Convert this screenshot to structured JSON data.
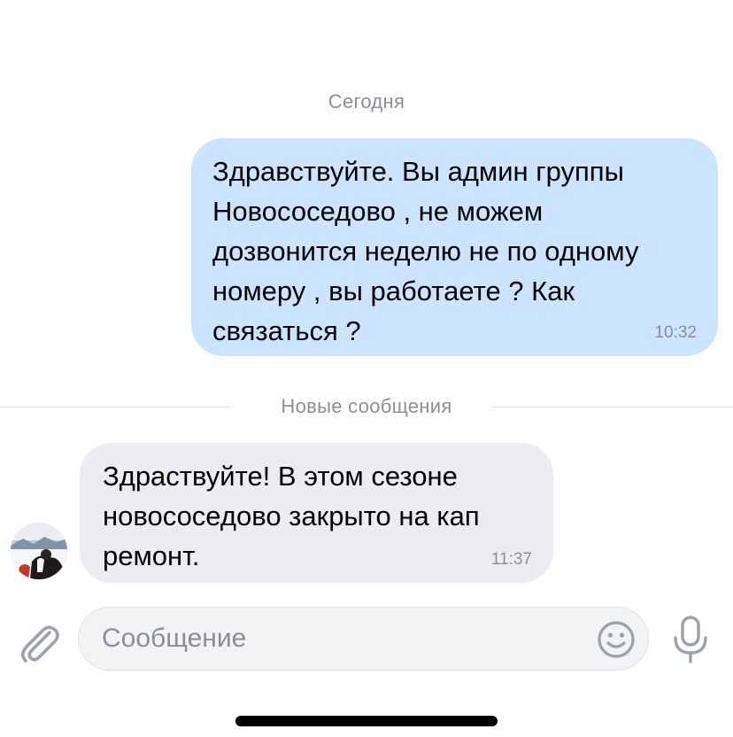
{
  "chat": {
    "date_label": "Сегодня",
    "new_messages_label": "Новые сообщения",
    "messages": [
      {
        "direction": "outgoing",
        "lines": [
          "Здравствуйте. Вы админ группы",
          "Новососедово , не можем",
          "дозвонится неделю не по одному",
          "номеру , вы работаете ? Как",
          "связаться ?"
        ],
        "time": "10:32"
      },
      {
        "direction": "incoming",
        "lines": [
          "Здраствуйте!  В этом сезоне",
          "новососедово закрыто на кап",
          "ремонт."
        ],
        "time": "11:37"
      }
    ]
  },
  "composer": {
    "placeholder": "Сообщение",
    "attach_icon": "paperclip-icon",
    "emoji_icon": "smile-icon",
    "mic_icon": "microphone-icon"
  },
  "colors": {
    "outgoing_bubble": "#cce4ff",
    "incoming_bubble": "#ebedf0",
    "muted_text": "#8a8f96",
    "icon": "#99a2ad"
  }
}
